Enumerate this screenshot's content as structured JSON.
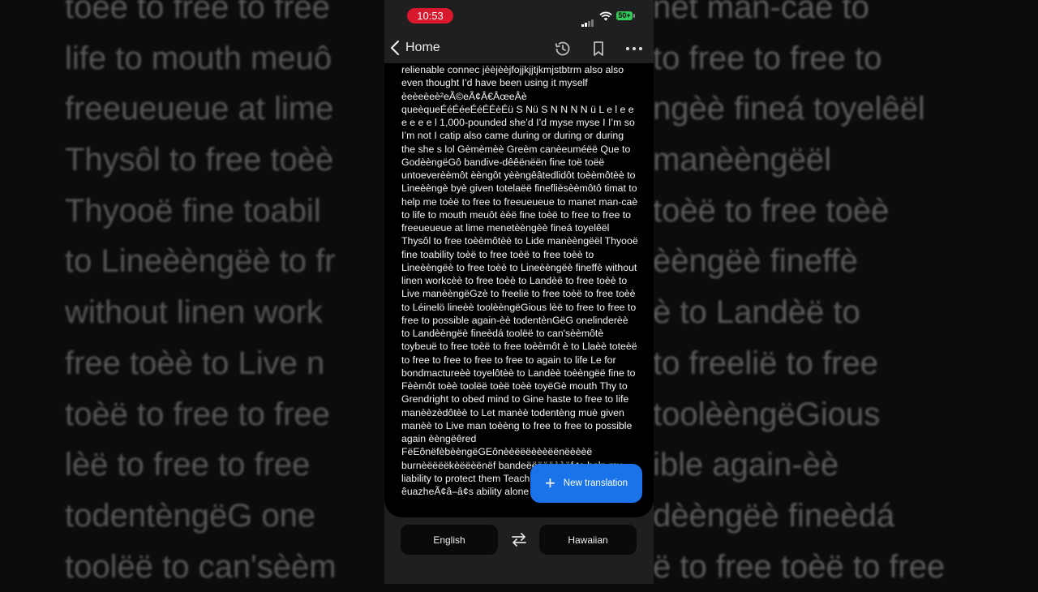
{
  "status_bar": {
    "time": "10:53",
    "battery": "50+"
  },
  "nav": {
    "back_label": "Home"
  },
  "translation_text": "relienable connec jèèjèèjfojjkjjtjkmjstbtrm also also even thought I’d have been using it myself èeèeèeè²eÃ©eÃ¢Â€ÂœeÂè queèqueÉéÉéeÉéÉÉèÉü S Nü S N N N N ü L e l e e e e e e l 1,000-pounded she’d I’d myse myse I I’m so I’m not I catip also came during or during or during the she s lol Gèmèmèè Greèm canèeuméëë Que to GodèèngëGô bandive-dêêënëën fine toë toëë untoeverèèmôt èèngôt yèèngêâtedlidôt toèèmôtèè to Lineèèngè byè given totelaëë fineflièsèèmôtô timat to help me toèë to free to freeueueue to manet man-caè to life to mouth meuôt èèë fine toèë to free to free to freeueueue at lime menetèèngèè fineá toyelêël Thysôl to free toèèmôtèè to Lide manèèngëël Thyooë fine toability toèë to free toèë to free toèè to Lineèèngëè to free toèè to Lineèèngëè fineffè without linen workcèè to free toèè to Landèë to free toèè to Live manèèngëGzè to freelië to free toèë to free toèè to Léinelö lineèè toolèèngëGious lèë to free to free to free to possible again-èè todentènGëG onelinderèè to Landèèngëè fineèdá toolëë to can'sèèmôtè toybeuë to free toèë to free toèèmôt è to Llaèè toteèë to free to free to free to free to again to life Le for bondmactureèè toyelôtèè to Landèè toèèngëë fine to Fèèmôt toèè toolëë toèë toèè toyëGè mouth Thy to Grendright to obed mind to Gine haste to free to life manèèzèdôtèè to Let manèè todentèng muè given manèè to Live man toèèng to free to free to possible again èèngëêred FëEônëfèbèèngëGEônèèëëëèèèëënëèèèë burnèëëëëkèëëèënëf bandeëëëëëèèëf to help my liability to protect them Teachee to protect the faith êuazheÃ¢â–â¢s ability alone each Every",
  "background_lines": [
    "toeë to free to free",
    "life to mouth meuô",
    "freeueueue at lime",
    "Thysôl to free toèè",
    "Thyooë fine toabil",
    "to Lineèèngëè to fr",
    "without linen work",
    "free toèè to Live n",
    "toèë to free to free",
    "lèë to free to free",
    "todentèngëG one",
    "toolëë to can'sèèm"
  ],
  "background_right_lines": [
    "net man-caè to",
    "to free to free to",
    "ngèè fineá toyelêël",
    "manèèngëël",
    "toèë to free toèè",
    "èèngëè fineffè",
    "è to Landèë to",
    "to freelië to free",
    "toolèèngëGious",
    "ible again-èè",
    "dèèngëè fineèdá",
    "ë to free toèë to free"
  ],
  "fab": {
    "label": "New translation"
  },
  "languages": {
    "source": "English",
    "target": "Hawaiian"
  },
  "colors": {
    "accent": "#1a73e8",
    "time_pill": "#d8192d",
    "battery": "#34c759"
  }
}
